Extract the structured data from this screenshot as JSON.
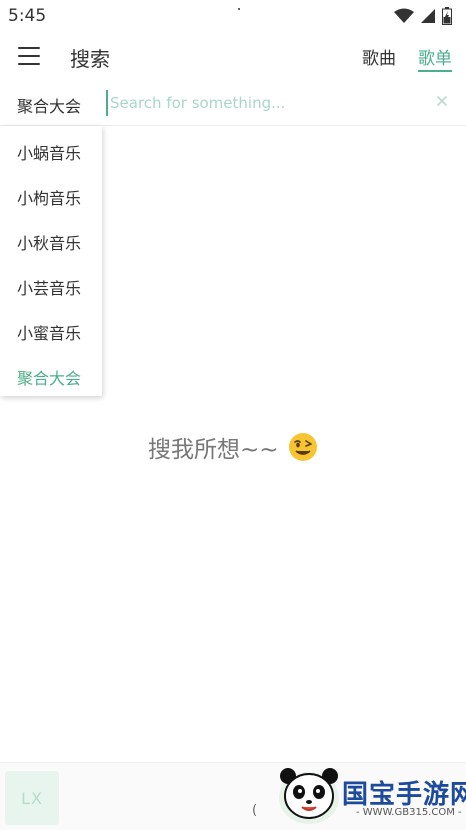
{
  "status": {
    "time": "5:45",
    "icons": [
      "wifi-icon",
      "signal-icon",
      "battery-icon"
    ]
  },
  "header": {
    "title": "搜索",
    "tabs": [
      {
        "label": "歌曲",
        "active": false
      },
      {
        "label": "歌单",
        "active": true
      }
    ]
  },
  "search": {
    "source": "聚合大会",
    "placeholder": "Search for something..."
  },
  "dropdown": {
    "items": [
      {
        "label": "小蜗音乐",
        "active": false
      },
      {
        "label": "小枸音乐",
        "active": false
      },
      {
        "label": "小秋音乐",
        "active": false
      },
      {
        "label": "小芸音乐",
        "active": false
      },
      {
        "label": "小蜜音乐",
        "active": false
      },
      {
        "label": "聚合大会",
        "active": true
      }
    ]
  },
  "empty_state": {
    "text": "搜我所想~~"
  },
  "bottom": {
    "logo": "LX",
    "paren": "("
  },
  "watermark": {
    "name": "国宝手游网",
    "url": "- WWW.GB315.COM -"
  },
  "colors": {
    "accent": "#4caf8a",
    "placeholder": "#a8d8c5",
    "watermark_blue": "#1c4a9c"
  }
}
